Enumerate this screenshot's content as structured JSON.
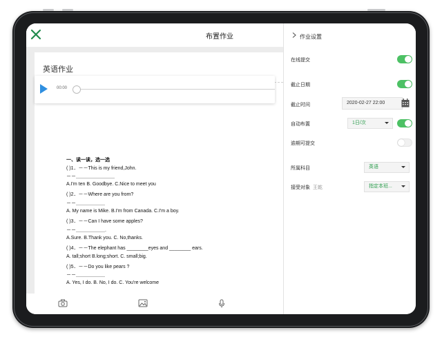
{
  "header": {
    "title": "布置作业"
  },
  "editor": {
    "homework_title": "英语作业",
    "audio": {
      "time": "00:00"
    },
    "exercise": [
      "一、读一读，选一选",
      "(    )1．－－This is my friend,John.",
      "－－＿＿＿＿＿＿＿＿",
      "A.I'm ten      B. Goodbye.    C.Nice to meet you",
      "(    )2．－－Where are you from?",
      "－－＿＿＿＿＿＿",
      "A. My name is Mike.   B.I'm from Canada.   C.I'm a boy.",
      "(    )3．－－Can I have some apples?",
      "－－＿＿＿＿＿＿.",
      "A.Sure.    B.Thank you.   C. No,thanks.",
      "(    )4．－－The elephant has ________eyes and ________ ears.",
      "A.  tall;short   B.long;short.  C. small;big.",
      "(    )5．－－Do you like pears ?",
      "－－＿＿＿＿＿＿",
      "A.  Yes, I do.   B. No, I do.   C. You're welcome"
    ]
  },
  "settings": {
    "title": "作业设置",
    "online_submit": {
      "label": "在线提交",
      "enabled": true
    },
    "due_date": {
      "label": "截止日期",
      "enabled": true
    },
    "due_time": {
      "label": "截止时间",
      "value": "2020-02-27 22:00"
    },
    "auto_assign": {
      "label": "自动布置",
      "value": "1日/次",
      "enabled": true
    },
    "late_submit": {
      "label": "逾期可提交",
      "enabled": false
    },
    "subject": {
      "label": "所属科目",
      "value": "英语"
    },
    "receiver": {
      "label": "接受对象",
      "name": "王乾",
      "value": "指定本班..."
    }
  },
  "colors": {
    "accent": "#4cc164",
    "accent_text": "#2e9e4f",
    "close_icon": "#1f8a4c",
    "play": "#2f8fe0"
  },
  "icons": [
    "close-icon",
    "play-icon",
    "camera-icon",
    "image-icon",
    "microphone-icon",
    "chevron-right-icon",
    "calendar-icon",
    "chevron-down-icon"
  ]
}
